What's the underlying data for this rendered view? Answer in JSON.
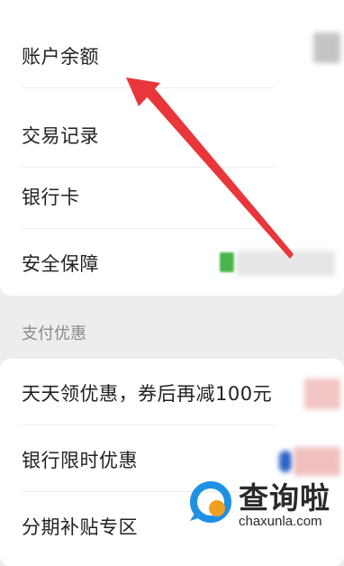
{
  "menu": {
    "items": [
      {
        "label": "账户余额"
      },
      {
        "label": "交易记录"
      },
      {
        "label": "银行卡"
      },
      {
        "label": "安全保障"
      }
    ]
  },
  "promotions": {
    "section_title": "支付优惠",
    "items": [
      {
        "label": "天天领优惠，券后再减100元"
      },
      {
        "label": "银行限时优惠"
      },
      {
        "label": "分期补贴专区"
      }
    ]
  },
  "annotation": {
    "arrow_color": "#e8363a"
  },
  "watermark": {
    "name": "查询啦",
    "url": "chaxunla.com",
    "icon": "magnifier-logo-icon",
    "colors": [
      "#1e90e6",
      "#f0a020"
    ]
  }
}
